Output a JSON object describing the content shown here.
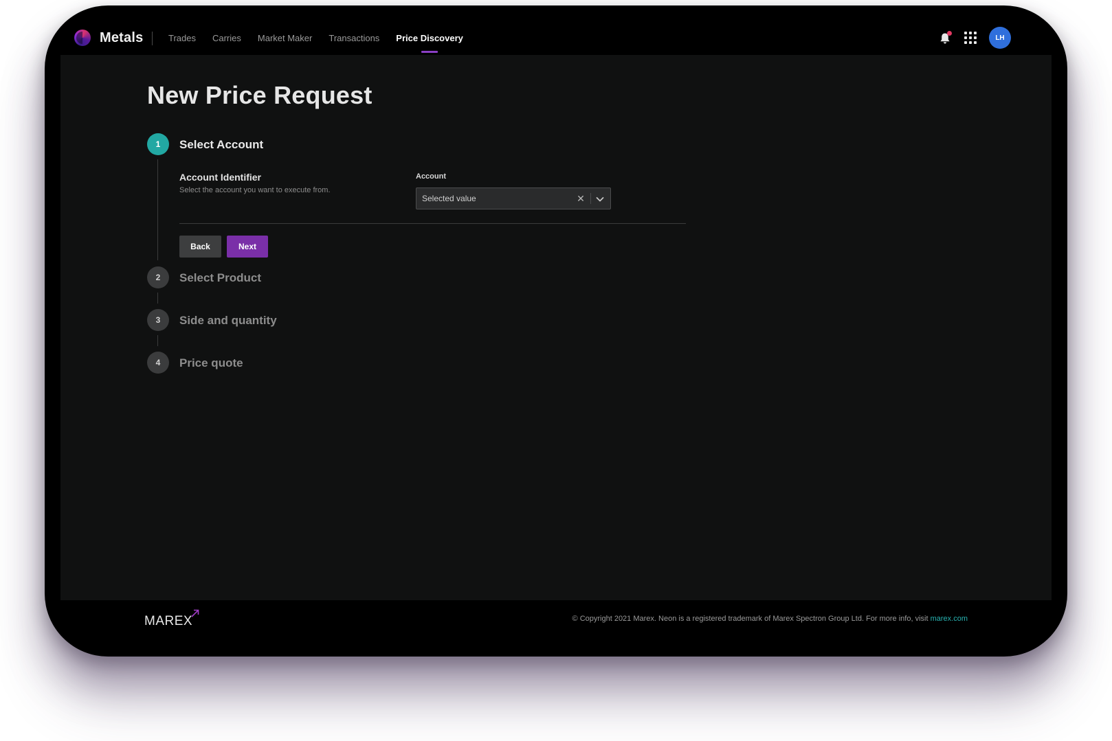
{
  "app": {
    "name": "Metals"
  },
  "nav": {
    "items": [
      {
        "label": "Trades",
        "active": false
      },
      {
        "label": "Carries",
        "active": false
      },
      {
        "label": "Market Maker",
        "active": false
      },
      {
        "label": "Transactions",
        "active": false
      },
      {
        "label": "Price Discovery",
        "active": true
      }
    ]
  },
  "header": {
    "notification_icon": "bell-icon",
    "apps_icon": "grid-icon",
    "avatar_initials": "LH"
  },
  "page": {
    "title": "New Price Request"
  },
  "steps": [
    {
      "number": "1",
      "label": "Select Account",
      "state": "active"
    },
    {
      "number": "2",
      "label": "Select Product",
      "state": "upcoming"
    },
    {
      "number": "3",
      "label": "Side and quantity",
      "state": "upcoming"
    },
    {
      "number": "4",
      "label": "Price quote",
      "state": "upcoming"
    }
  ],
  "account_step": {
    "field_title": "Account Identifier",
    "field_description": "Select the account you want to execute from.",
    "select_label": "Account",
    "select_value": "Selected value",
    "clear_icon": "close-icon",
    "dropdown_icon": "chevron-down-icon",
    "back_label": "Back",
    "next_label": "Next"
  },
  "footer": {
    "brand": "MAREX",
    "copyright": "© Copyright 2021 Marex. Neon is a registered trademark of Marex Spectron Group Ltd. For more info, visit ",
    "link_text": "marex.com"
  },
  "colors": {
    "accent_purple": "#7a2fa8",
    "active_step_teal": "#22a8a3",
    "link_teal": "#28b2b0",
    "avatar_blue": "#2f6fdc",
    "notification_red": "#e23a63"
  }
}
